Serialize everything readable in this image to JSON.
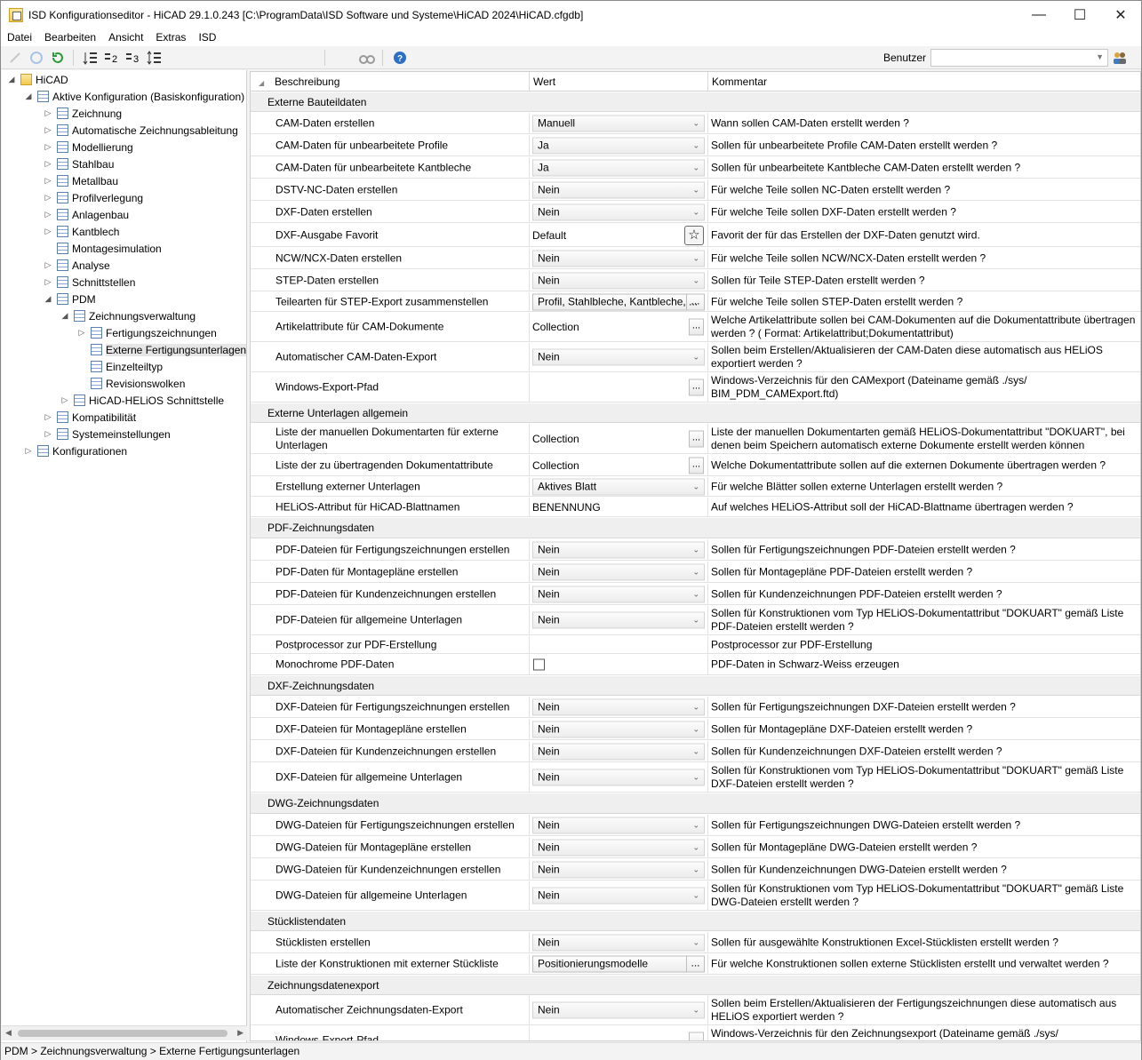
{
  "window": {
    "title": "ISD Konfigurationseditor  - HiCAD 29.1.0.243 [C:\\ProgramData\\ISD Software und Systeme\\HiCAD 2024\\HiCAD.cfgdb]",
    "minimize": "—",
    "maximize": "☐",
    "close": "✕"
  },
  "menu": [
    "Datei",
    "Bearbeiten",
    "Ansicht",
    "Extras",
    "ISD"
  ],
  "toolbar": {
    "user_label": "Benutzer",
    "user_value": ""
  },
  "tree": [
    {
      "label": "HiCAD",
      "level": 0,
      "expander": "◢",
      "icon": "root"
    },
    {
      "label": "Aktive Konfiguration (Basiskonfiguration)",
      "level": 1,
      "expander": "◢",
      "icon": "table"
    },
    {
      "label": "Zeichnung",
      "level": 2,
      "expander": "▷",
      "icon": "table"
    },
    {
      "label": "Automatische Zeichnungsableitung",
      "level": 2,
      "expander": "▷",
      "icon": "table"
    },
    {
      "label": "Modellierung",
      "level": 2,
      "expander": "▷",
      "icon": "table"
    },
    {
      "label": "Stahlbau",
      "level": 2,
      "expander": "▷",
      "icon": "table"
    },
    {
      "label": "Metallbau",
      "level": 2,
      "expander": "▷",
      "icon": "table"
    },
    {
      "label": "Profilverlegung",
      "level": 2,
      "expander": "▷",
      "icon": "table"
    },
    {
      "label": "Anlagenbau",
      "level": 2,
      "expander": "▷",
      "icon": "table"
    },
    {
      "label": "Kantblech",
      "level": 2,
      "expander": "▷",
      "icon": "table"
    },
    {
      "label": "Montagesimulation",
      "level": 2,
      "expander": "",
      "icon": "table"
    },
    {
      "label": "Analyse",
      "level": 2,
      "expander": "▷",
      "icon": "table"
    },
    {
      "label": "Schnittstellen",
      "level": 2,
      "expander": "▷",
      "icon": "table"
    },
    {
      "label": "PDM",
      "level": 2,
      "expander": "◢",
      "icon": "table"
    },
    {
      "label": "Zeichnungsverwaltung",
      "level": 3,
      "expander": "◢",
      "icon": "table"
    },
    {
      "label": "Fertigungszeichnungen",
      "level": 4,
      "expander": "▷",
      "icon": "table"
    },
    {
      "label": "Externe Fertigungsunterlagen",
      "level": 4,
      "expander": "",
      "icon": "table",
      "selected": true
    },
    {
      "label": "Einzelteiltyp",
      "level": 4,
      "expander": "",
      "icon": "table"
    },
    {
      "label": "Revisionswolken",
      "level": 4,
      "expander": "",
      "icon": "table"
    },
    {
      "label": "HiCAD-HELiOS Schnittstelle",
      "level": 3,
      "expander": "▷",
      "icon": "table"
    },
    {
      "label": "Kompatibilität",
      "level": 2,
      "expander": "▷",
      "icon": "table"
    },
    {
      "label": "Systemeinstellungen",
      "level": 2,
      "expander": "▷",
      "icon": "table"
    },
    {
      "label": "Konfigurationen",
      "level": 1,
      "expander": "▷",
      "icon": "table"
    }
  ],
  "grid": {
    "headers": {
      "desc": "Beschreibung",
      "value": "Wert",
      "comment": "Kommentar"
    },
    "rows": [
      {
        "group": "Externe Bauteildaten"
      },
      {
        "desc": "CAM-Daten erstellen",
        "type": "dropdown",
        "value": "Manuell",
        "comment": "Wann sollen CAM-Daten erstellt werden ?"
      },
      {
        "desc": "CAM-Daten für unbearbeitete Profile",
        "type": "dropdown",
        "value": "Ja",
        "comment": "Sollen für unbearbeitete Profile CAM-Daten erstellt werden ?"
      },
      {
        "desc": "CAM-Daten für unbearbeitete Kantbleche",
        "type": "dropdown",
        "value": "Ja",
        "comment": "Sollen für unbearbeitete Kantbleche CAM-Daten erstellt werden ?"
      },
      {
        "desc": "DSTV-NC-Daten erstellen",
        "type": "dropdown",
        "value": "Nein",
        "comment": "Für welche Teile sollen NC-Daten erstellt werden ?"
      },
      {
        "desc": "DXF-Daten erstellen",
        "type": "dropdown",
        "value": "Nein",
        "comment": "Für welche Teile sollen DXF-Daten erstellt werden ?"
      },
      {
        "desc": "DXF-Ausgabe Favorit",
        "type": "star",
        "value": "Default",
        "comment": "Favorit der für das Erstellen der DXF-Daten genutzt wird."
      },
      {
        "desc": "NCW/NCX-Daten erstellen",
        "type": "dropdown",
        "value": "Nein",
        "comment": "Für welche Teile sollen NCW/NCX-Daten erstellt werden ?"
      },
      {
        "desc": "STEP-Daten erstellen",
        "type": "dropdown",
        "value": "Nein",
        "comment": "Sollen für Teile STEP-Daten erstellt werden ?"
      },
      {
        "desc": "Teilearten für STEP-Export zusammenstellen",
        "type": "comboell",
        "value": "Profil, Stahlbleche, Kantbleche, ...",
        "comment": "Für welche Teile sollen STEP-Daten erstellt werden ?"
      },
      {
        "desc": "Artikelattribute für CAM-Dokumente",
        "type": "ell",
        "value": "Collection",
        "comment": "Welche Artikelattribute sollen bei CAM-Dokumenten auf die Dokumentattribute übertragen werden ? ( Format: Artikelattribut;Dokumentattribut)"
      },
      {
        "desc": "Automatischer CAM-Daten-Export",
        "type": "dropdown",
        "value": "Nein",
        "comment": "Sollen beim Erstellen/Aktualisieren der CAM-Daten diese automatisch aus HELiOS exportiert werden ?"
      },
      {
        "desc": "Windows-Export-Pfad",
        "type": "ell",
        "value": "",
        "comment": "Windows-Verzeichnis für den CAMexport (Dateiname gemäß ./sys/ BIM_PDM_CAMExport.ftd)"
      },
      {
        "group": "Externe Unterlagen allgemein"
      },
      {
        "desc": "Liste der manuellen Dokumentarten für externe Unterlagen",
        "type": "ell",
        "value": "Collection",
        "comment": "Liste der manuellen  Dokumentarten gemäß HELiOS-Dokumentattribut \"DOKUART\", bei denen beim Speichern automatisch externe Dokumente erstellt werden können"
      },
      {
        "desc": "Liste der zu übertragenden Dokumentattribute",
        "type": "ell",
        "value": "Collection",
        "comment": "Welche Dokumentattribute sollen auf die externen Dokumente übertragen werden ?"
      },
      {
        "desc": "Erstellung externer Unterlagen",
        "type": "dropdown",
        "value": "Aktives Blatt",
        "comment": "Für welche Blätter sollen externe Unterlagen erstellt werden ?"
      },
      {
        "desc": "HELiOS-Attribut für HiCAD-Blattnamen",
        "type": "text",
        "value": "BENENNUNG",
        "comment": "Auf welches HELiOS-Attribut soll der HiCAD-Blattname übertragen werden ?"
      },
      {
        "group": "PDF-Zeichnungsdaten"
      },
      {
        "desc": "PDF-Dateien für Fertigungszeichnungen erstellen",
        "type": "dropdown",
        "value": "Nein",
        "comment": "Sollen für Fertigungszeichnungen PDF-Dateien erstellt werden ?"
      },
      {
        "desc": "PDF-Daten für Montagepläne erstellen",
        "type": "dropdown",
        "value": "Nein",
        "comment": "Sollen für Montagepläne PDF-Dateien erstellt werden ?"
      },
      {
        "desc": "PDF-Dateien für Kundenzeichnungen erstellen",
        "type": "dropdown",
        "value": "Nein",
        "comment": "Sollen für Kundenzeichnungen PDF-Dateien erstellt werden ?"
      },
      {
        "desc": "PDF-Dateien für allgemeine Unterlagen",
        "type": "dropdown",
        "value": "Nein",
        "comment": "Sollen für Konstruktionen vom Typ HELiOS-Dokumentattribut \"DOKUART\" gemäß Liste PDF-Dateien erstellt werden ?"
      },
      {
        "desc": "Postprocessor zur PDF-Erstellung",
        "type": "text",
        "value": "",
        "comment": "Postprocessor zur PDF-Erstellung"
      },
      {
        "desc": "Monochrome PDF-Daten",
        "type": "check",
        "value": "",
        "comment": "PDF-Daten in Schwarz-Weiss erzeugen"
      },
      {
        "group": "DXF-Zeichnungsdaten"
      },
      {
        "desc": "DXF-Dateien für Fertigungszeichnungen erstellen",
        "type": "dropdown",
        "value": "Nein",
        "comment": "Sollen für Fertigungszeichnungen DXF-Dateien erstellt werden ?"
      },
      {
        "desc": "DXF-Dateien für Montagepläne erstellen",
        "type": "dropdown",
        "value": "Nein",
        "comment": "Sollen für Montagepläne DXF-Dateien erstellt werden ?"
      },
      {
        "desc": "DXF-Dateien für Kundenzeichnungen erstellen",
        "type": "dropdown",
        "value": "Nein",
        "comment": "Sollen für Kundenzeichnungen DXF-Dateien erstellt werden ?"
      },
      {
        "desc": "DXF-Dateien für allgemeine Unterlagen",
        "type": "dropdown",
        "value": "Nein",
        "comment": "Sollen für Konstruktionen vom Typ HELiOS-Dokumentattribut \"DOKUART\" gemäß Liste DXF-Dateien erstellt werden ?"
      },
      {
        "group": "DWG-Zeichnungsdaten"
      },
      {
        "desc": "DWG-Dateien für Fertigungszeichnungen erstellen",
        "type": "dropdown",
        "value": "Nein",
        "comment": "Sollen für Fertigungszeichnungen DWG-Dateien erstellt werden ?"
      },
      {
        "desc": "DWG-Dateien für Montagepläne erstellen",
        "type": "dropdown",
        "value": "Nein",
        "comment": "Sollen für Montagepläne DWG-Dateien erstellt werden ?"
      },
      {
        "desc": "DWG-Dateien für Kundenzeichnungen erstellen",
        "type": "dropdown",
        "value": "Nein",
        "comment": "Sollen für Kundenzeichnungen DWG-Dateien erstellt werden ?"
      },
      {
        "desc": "DWG-Dateien für allgemeine Unterlagen",
        "type": "dropdown",
        "value": "Nein",
        "comment": "Sollen für Konstruktionen vom Typ HELiOS-Dokumentattribut \"DOKUART\" gemäß Liste DWG-Dateien erstellt werden ?"
      },
      {
        "group": "Stücklistendaten"
      },
      {
        "desc": "Stücklisten erstellen",
        "type": "dropdown",
        "value": "Nein",
        "comment": "Sollen für ausgewählte Konstruktionen Excel-Stücklisten erstellt werden ?"
      },
      {
        "desc": "Liste der Konstruktionen mit externer Stückliste",
        "type": "comboell",
        "value": "Positionierungsmodelle",
        "comment": "Für welche Konstruktionen sollen externe Stücklisten erstellt und verwaltet werden ?"
      },
      {
        "group": "Zeichnungsdatenexport"
      },
      {
        "desc": "Automatischer Zeichnungsdaten-Export",
        "type": "dropdown",
        "value": "Nein",
        "comment": "Sollen beim Erstellen/Aktualisieren der Fertigungszeichnungen diese automatisch aus HELiOS exportiert werden ?"
      },
      {
        "desc": "Windows-Export-Pfad",
        "type": "ell",
        "value": "",
        "comment": "Windows-Verzeichnis für den Zeichnungsexport (Dateiname gemäß ./sys/ BIM_PDM_WSDExport.ftd)"
      }
    ]
  },
  "statusbar": {
    "breadcrumb": "PDM > Zeichnungsverwaltung > Externe Fertigungsunterlagen"
  }
}
